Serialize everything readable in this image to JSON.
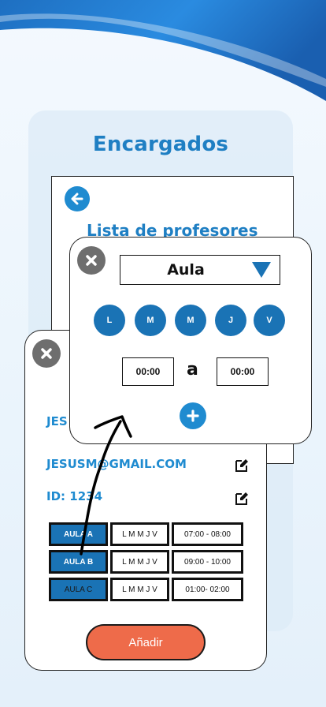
{
  "header": {
    "title": "Encargados"
  },
  "teacher_list": {
    "title": "Lista de profesores"
  },
  "user": {
    "name_partial": "JES",
    "email": "JESUSM@GMAIL.COM",
    "id_text": "ID: 1234"
  },
  "schedule": [
    {
      "aula": "AULA A",
      "days": "L M M J V",
      "time": "07:00 - 08:00"
    },
    {
      "aula": "AULA B",
      "days": "L M M J V",
      "time": "09:00 - 10:00"
    },
    {
      "aula": "AULA C",
      "days": "L M M J V",
      "time": "01:00- 02:00"
    }
  ],
  "add_button": {
    "label": "Añadir"
  },
  "aula_popup": {
    "select_label": "Aula",
    "days": [
      "L",
      "M",
      "M",
      "J",
      "V"
    ],
    "time_from": "00:00",
    "separator": "a",
    "time_to": "00:00"
  },
  "colors": {
    "primary": "#1a73b5",
    "accent": "#1f8bd0",
    "title": "#1f7fc3",
    "button": "#ee6b4a",
    "close": "#6e6e6e"
  },
  "icons": {
    "back": "arrow-left-icon",
    "close": "close-icon",
    "edit": "edit-icon",
    "dropdown": "triangle-down-icon",
    "add": "plus-icon"
  }
}
